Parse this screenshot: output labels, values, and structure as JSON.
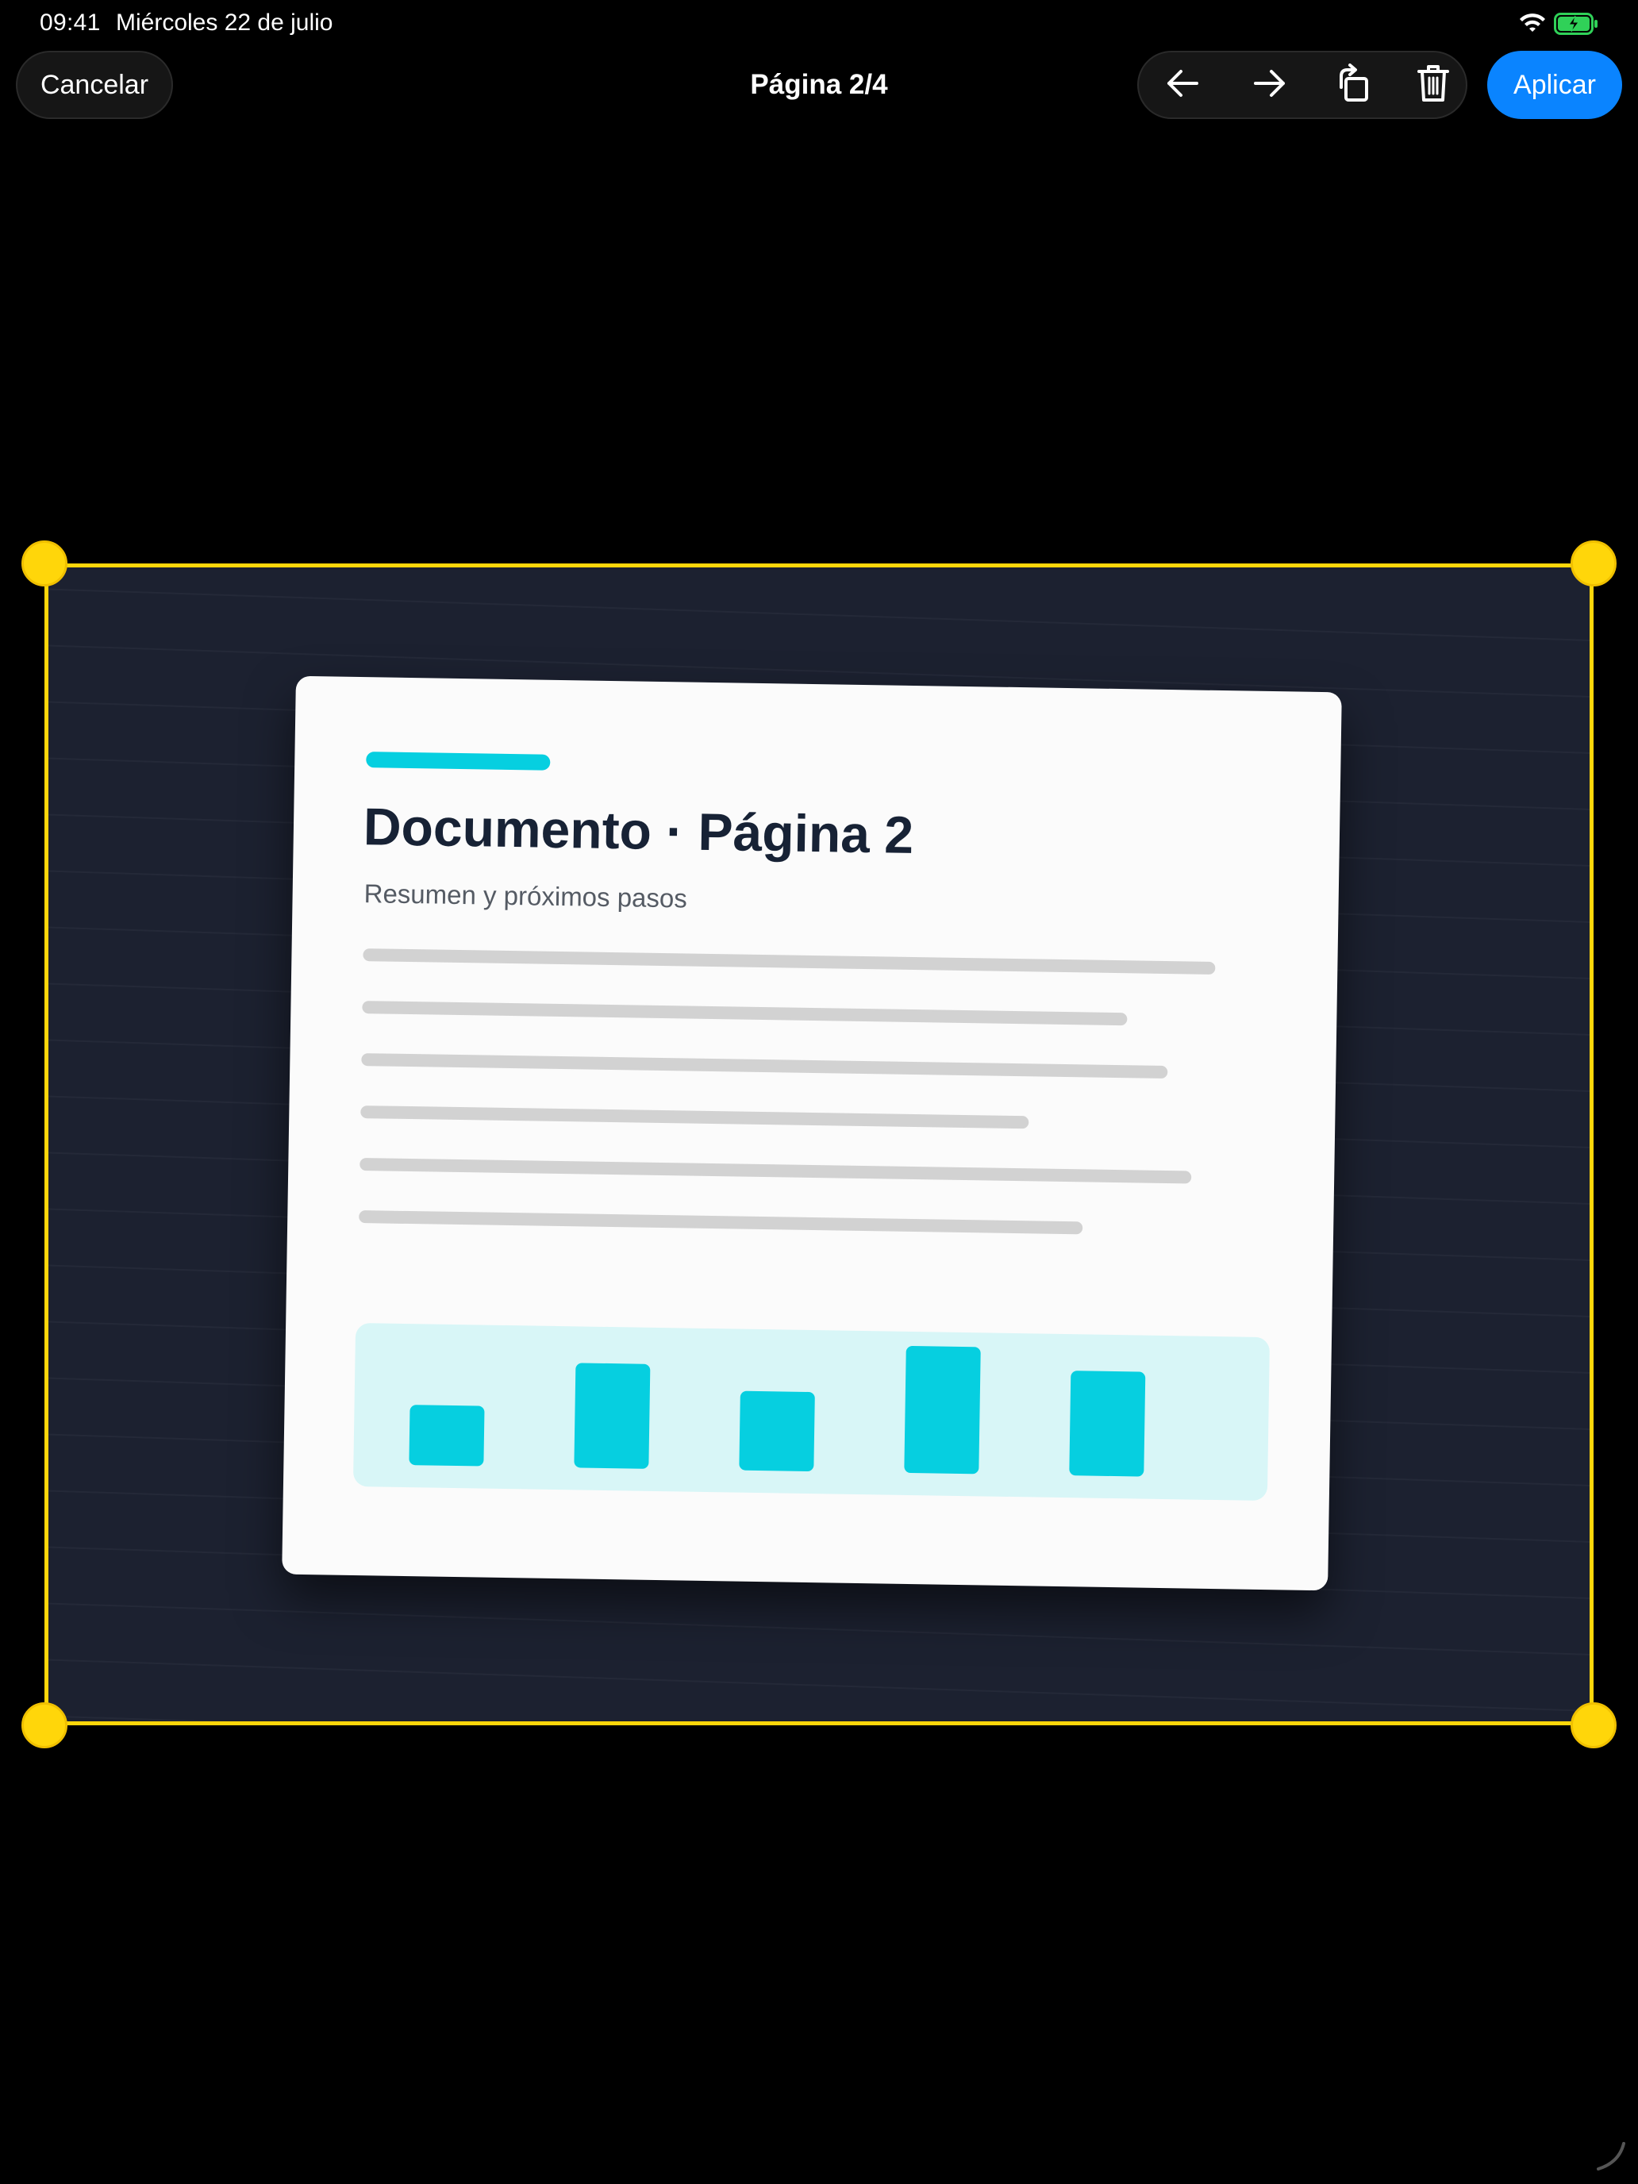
{
  "status_bar": {
    "time": "09:41",
    "date": "Miércoles 22 de julio",
    "wifi_icon": "wifi-icon",
    "battery_icon": "battery-charging-icon",
    "battery_color": "#30d158"
  },
  "toolbar": {
    "cancel_label": "Cancelar",
    "page_title": "Página 2/4",
    "tools": [
      {
        "name": "previous-page-button",
        "icon": "arrow-left-icon"
      },
      {
        "name": "next-page-button",
        "icon": "arrow-right-icon"
      },
      {
        "name": "rotate-button",
        "icon": "rotate-icon"
      },
      {
        "name": "delete-button",
        "icon": "trash-icon"
      }
    ],
    "apply_label": "Aplicar"
  },
  "document": {
    "title": "Documento · Página 2",
    "subtitle": "Resumen y próximos pasos",
    "text_line_count": 6,
    "chart_bar_levels": [
      0.38,
      0.66,
      0.5,
      0.8,
      0.66
    ],
    "accent_color": "#06cfe0"
  },
  "crop": {
    "frame_color": "#ffd60a",
    "handles": [
      "top-left",
      "top-right",
      "bottom-left",
      "bottom-right"
    ]
  },
  "colors": {
    "background": "#000000",
    "apply_button": "#0a84ff",
    "surface": "#1c2130",
    "doc_title": "#172235"
  }
}
